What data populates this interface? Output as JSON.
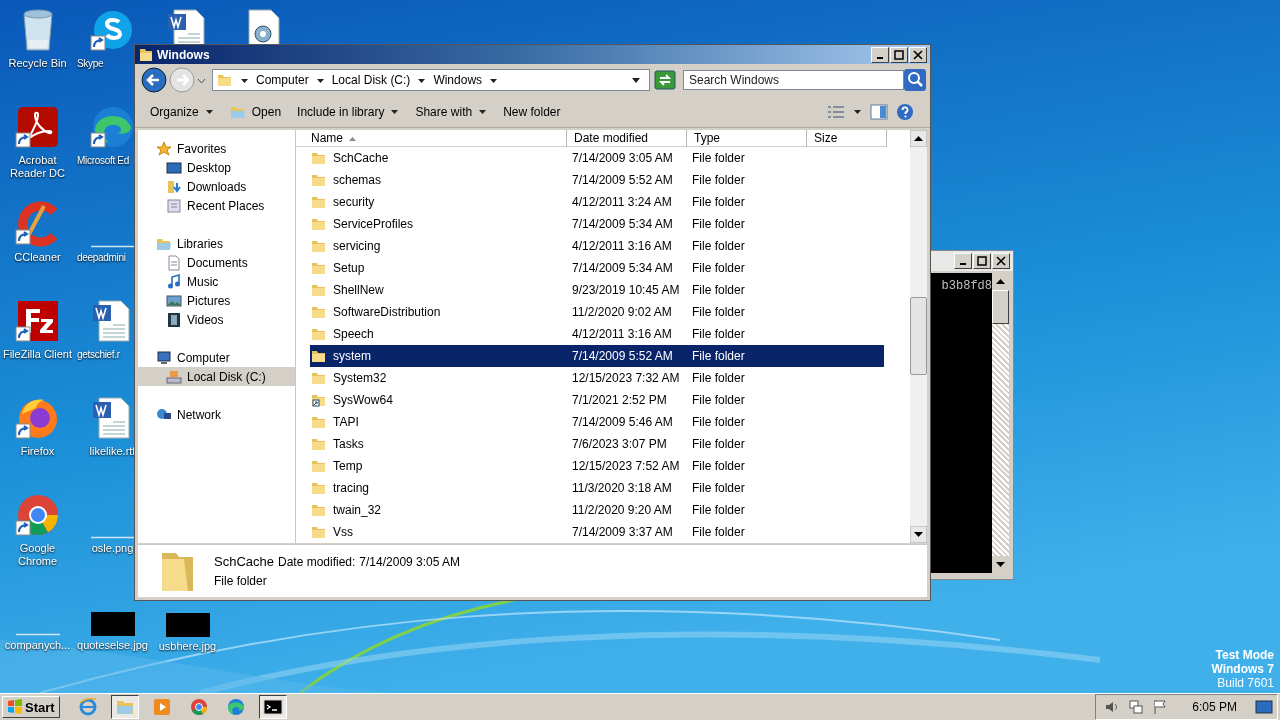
{
  "desktop": {
    "columns": [
      [
        {
          "kind": "recycle-bin",
          "label": "Recycle Bin",
          "shortcut": false
        },
        {
          "kind": "acrobat",
          "label": "Acrobat Reader DC",
          "shortcut": true
        },
        {
          "kind": "ccleaner",
          "label": "CCleaner",
          "shortcut": true
        },
        {
          "kind": "filezilla",
          "label": "FileZilla Client",
          "shortcut": true
        },
        {
          "kind": "firefox",
          "label": "Firefox",
          "shortcut": true
        },
        {
          "kind": "chrome",
          "label": "Google Chrome",
          "shortcut": true
        },
        {
          "kind": "blank-image",
          "label": "companych..."
        }
      ],
      [
        {
          "kind": "skype",
          "label": "Skype",
          "shortcut": true
        },
        {
          "kind": "edge",
          "label": "Microsoft Ed",
          "shortcut": true
        },
        {
          "kind": "blank-image",
          "label": "deepadmini"
        },
        {
          "kind": "word",
          "label": "getschief.r",
          "shortcut": false
        },
        {
          "kind": "word",
          "label": "likelike.rtf",
          "shortcut": false
        },
        {
          "kind": "blank-image",
          "label": "osle.png"
        },
        {
          "kind": "dark-image",
          "label": "quoteselse.jpg"
        }
      ],
      [
        {
          "kind": "word",
          "shortcut": false
        },
        {
          "kind": "dark-image",
          "label": "usbhere.jpg"
        }
      ],
      [
        {
          "kind": "gear-doc",
          "shortcut": false
        }
      ]
    ]
  },
  "console": {
    "text": "b3b8fd8"
  },
  "explorer": {
    "title": "Windows",
    "breadcrumb": [
      "Computer",
      "Local Disk (C:)",
      "Windows"
    ],
    "search": {
      "placeholder": "Search Windows"
    },
    "toolbar": [
      {
        "label": "Organize",
        "kind": "menu"
      },
      {
        "label": "Open",
        "kind": "icon-button"
      },
      {
        "label": "Include in library",
        "kind": "menu"
      },
      {
        "label": "Share with",
        "kind": "menu"
      },
      {
        "label": "New folder",
        "kind": "button"
      }
    ],
    "nav": [
      {
        "label": "Favorites",
        "kind": "star",
        "selected": false,
        "children": [
          {
            "label": "Desktop",
            "kind": "desktop",
            "selected": false
          },
          {
            "label": "Downloads",
            "kind": "downloads",
            "selected": false
          },
          {
            "label": "Recent Places",
            "kind": "recent",
            "selected": false
          }
        ]
      },
      {
        "label": "Libraries",
        "kind": "library",
        "selected": false,
        "children": [
          {
            "label": "Documents",
            "kind": "documents",
            "selected": false
          },
          {
            "label": "Music",
            "kind": "music",
            "selected": false
          },
          {
            "label": "Pictures",
            "kind": "pictures",
            "selected": false
          },
          {
            "label": "Videos",
            "kind": "videos",
            "selected": false
          }
        ]
      },
      {
        "label": "Computer",
        "kind": "computer",
        "selected": false,
        "children": [
          {
            "label": "Local Disk (C:)",
            "kind": "disk",
            "selected": true
          }
        ]
      },
      {
        "label": "Network",
        "kind": "network",
        "selected": false
      }
    ],
    "columns": [
      "Name",
      "Date modified",
      "Type",
      "Size"
    ],
    "files": [
      {
        "name": "SchCache",
        "date": "7/14/2009 3:05 AM",
        "type": "File folder",
        "kind": "folder",
        "selected": false
      },
      {
        "name": "schemas",
        "date": "7/14/2009 5:52 AM",
        "type": "File folder",
        "kind": "folder",
        "selected": false
      },
      {
        "name": "security",
        "date": "4/12/2011 3:24 AM",
        "type": "File folder",
        "kind": "folder",
        "selected": false
      },
      {
        "name": "ServiceProfiles",
        "date": "7/14/2009 5:34 AM",
        "type": "File folder",
        "kind": "folder",
        "selected": false
      },
      {
        "name": "servicing",
        "date": "4/12/2011 3:16 AM",
        "type": "File folder",
        "kind": "folder",
        "selected": false
      },
      {
        "name": "Setup",
        "date": "7/14/2009 5:34 AM",
        "type": "File folder",
        "kind": "folder",
        "selected": false
      },
      {
        "name": "ShellNew",
        "date": "9/23/2019 10:45 AM",
        "type": "File folder",
        "kind": "folder",
        "selected": false
      },
      {
        "name": "SoftwareDistribution",
        "date": "11/2/2020 9:02 AM",
        "type": "File folder",
        "kind": "folder",
        "selected": false
      },
      {
        "name": "Speech",
        "date": "4/12/2011 3:16 AM",
        "type": "File folder",
        "kind": "folder",
        "selected": false
      },
      {
        "name": "system",
        "date": "7/14/2009 5:52 AM",
        "type": "File folder",
        "kind": "folder",
        "selected": true
      },
      {
        "name": "System32",
        "date": "12/15/2023 7:32 AM",
        "type": "File folder",
        "kind": "folder",
        "selected": false
      },
      {
        "name": "SysWow64",
        "date": "7/1/2021 2:52 PM",
        "type": "File folder",
        "kind": "link",
        "selected": false
      },
      {
        "name": "TAPI",
        "date": "7/14/2009 5:46 AM",
        "type": "File folder",
        "kind": "folder",
        "selected": false
      },
      {
        "name": "Tasks",
        "date": "7/6/2023 3:07 PM",
        "type": "File folder",
        "kind": "folder",
        "selected": false
      },
      {
        "name": "Temp",
        "date": "12/15/2023 7:52 AM",
        "type": "File folder",
        "kind": "folder",
        "selected": false
      },
      {
        "name": "tracing",
        "date": "11/3/2020 3:18 AM",
        "type": "File folder",
        "kind": "folder",
        "selected": false
      },
      {
        "name": "twain_32",
        "date": "11/2/2020 9:20 AM",
        "type": "File folder",
        "kind": "folder",
        "selected": false
      },
      {
        "name": "Vss",
        "date": "7/14/2009 3:37 AM",
        "type": "File folder",
        "kind": "folder",
        "selected": false
      }
    ],
    "details": {
      "name": "SchCache",
      "date_label": "Date modified:",
      "date": "7/14/2009 3:05 AM",
      "type": "File folder"
    }
  },
  "os_notice": [
    "Test Mode",
    "Windows 7",
    "Build 7601"
  ],
  "taskbar": {
    "start": "Start",
    "items": [
      {
        "kind": "ie",
        "active": false
      },
      {
        "kind": "explorer",
        "active": true
      },
      {
        "kind": "media",
        "active": false
      },
      {
        "kind": "chrome",
        "active": false
      },
      {
        "kind": "edge",
        "active": false
      },
      {
        "kind": "cmd",
        "active": true
      }
    ],
    "clock": "6:05 PM"
  }
}
